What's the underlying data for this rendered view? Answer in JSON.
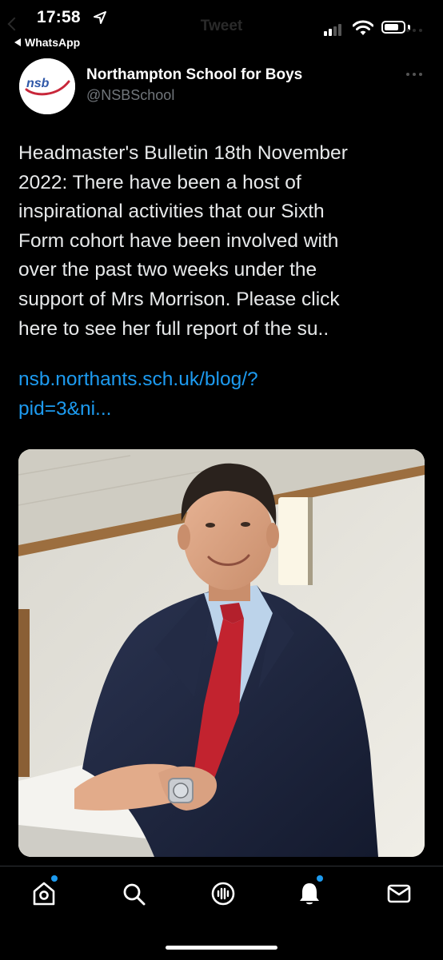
{
  "status_bar": {
    "time": "17:58",
    "back_app": "WhatsApp",
    "icons": [
      "location-arrow-icon",
      "cellular-signal-icon",
      "wifi-icon",
      "battery-icon"
    ]
  },
  "header": {
    "title": "Tweet"
  },
  "tweet": {
    "author": {
      "name": "Northampton School for Boys",
      "handle": "@NSBSchool",
      "avatar_text": "nsb"
    },
    "text_lines": [
      "Headmaster's Bulletin 18th November",
      "2022: There have been a host of",
      "inspirational activities that our Sixth",
      "Form cohort have been involved with",
      "over the past two weeks under the",
      "support of Mrs Morrison. Please click",
      "here to see her full report of the su.."
    ],
    "link_lines": [
      "nsb.northants.sch.uk/blog/?",
      "pid=3&ni..."
    ],
    "image_alt": "Photo of a man in a navy suit and red tie leaning on a white rail"
  },
  "tab_bar": {
    "tabs": [
      {
        "name": "home",
        "icon": "home-icon",
        "badge": true
      },
      {
        "name": "search",
        "icon": "search-icon",
        "badge": false
      },
      {
        "name": "spaces",
        "icon": "spaces-icon",
        "badge": false
      },
      {
        "name": "notifications",
        "icon": "bell-icon",
        "badge": true
      },
      {
        "name": "messages",
        "icon": "envelope-icon",
        "badge": false
      }
    ]
  },
  "colors": {
    "background": "#000000",
    "text": "#e7e9ea",
    "secondary_text": "#71767b",
    "link": "#1d9bf0",
    "badge": "#1d9bf0",
    "logo_blue": "#2f58a8",
    "logo_red": "#c8273a"
  }
}
